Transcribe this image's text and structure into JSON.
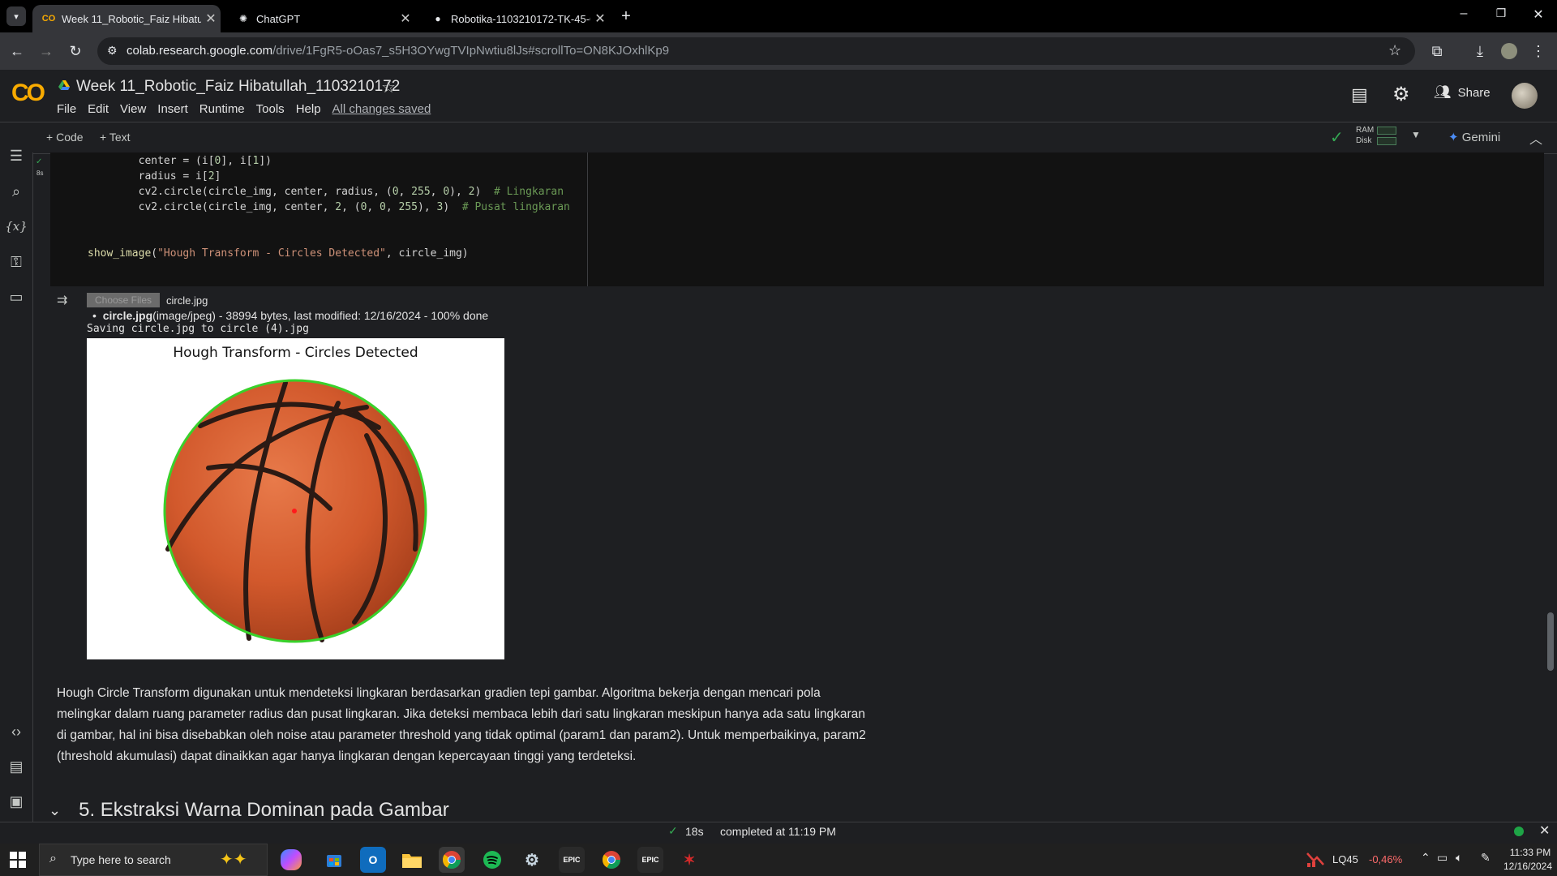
{
  "browser": {
    "tabs": [
      {
        "title": "Week 11_Robotic_Faiz Hibatullah",
        "icon": "colab-icon"
      },
      {
        "title": "ChatGPT",
        "icon": "chatgpt-icon"
      },
      {
        "title": "Robotika-1103210172-TK-45-G",
        "icon": "github-icon"
      }
    ],
    "url_host": "colab.research.google.com",
    "url_path": "/drive/1FgR5-oOas7_s5H3OYwgTVIpNwtiu8lJs#scrollTo=ON8KJOxhlKp9"
  },
  "colab": {
    "logo": "CO",
    "notebook_title": "Week 11_Robotic_Faiz Hibatullah_1103210172",
    "menu": [
      "File",
      "Edit",
      "View",
      "Insert",
      "Runtime",
      "Tools",
      "Help"
    ],
    "save_status": "All changes saved",
    "share_label": "Share",
    "add_code": "Code",
    "add_text": "Text",
    "ram_label": "RAM",
    "disk_label": "Disk",
    "gemini_label": "Gemini"
  },
  "code_cell": {
    "exec_time": "8s",
    "lines": [
      "        center = (i[0], i[1])",
      "        radius = i[2]",
      "        cv2.circle(circle_img, center, radius, (0, 255, 0), 2)  # Lingkaran",
      "        cv2.circle(circle_img, center, 2, (0, 0, 255), 3)  # Pusat lingkaran",
      "",
      "",
      "show_image(\"Hough Transform - Circles Detected\", circle_img)"
    ]
  },
  "output": {
    "choose_files_label": "Choose Files",
    "file_name": "circle.jpg",
    "upload_bold": "circle.jpg",
    "upload_detail": "(image/jpeg) - 38994 bytes, last modified: 12/16/2024 - 100% done",
    "saving_line": "Saving circle.jpg to circle (4).jpg",
    "plot_title": "Hough Transform - Circles Detected"
  },
  "markdown": {
    "text": "Hough Circle Transform digunakan untuk mendeteksi lingkaran berdasarkan gradien tepi gambar. Algoritma bekerja dengan mencari pola melingkar dalam ruang parameter radius dan pusat lingkaran. Jika deteksi membaca lebih dari satu lingkaran meskipun hanya ada satu lingkaran di gambar, hal ini bisa disebabkan oleh noise atau parameter threshold yang tidak optimal (param1 dan param2). Untuk memperbaikinya, param2 (threshold akumulasi) dapat dinaikkan agar hanya lingkaran dengan kepercayaan tinggi yang terdeteksi.",
    "section_heading": "5. Ekstraksi Warna Dominan pada Gambar"
  },
  "status": {
    "duration": "18s",
    "completed": "completed at 11:19 PM"
  },
  "taskbar": {
    "search_placeholder": "Type here to search",
    "stock_ticker": "LQ45",
    "stock_change": "-0,46%",
    "time": "11:33 PM",
    "date": "12/16/2024"
  },
  "colors": {
    "accent_orange": "#f9ab00",
    "green_check": "#34a853",
    "negative": "#ff6b6b"
  }
}
